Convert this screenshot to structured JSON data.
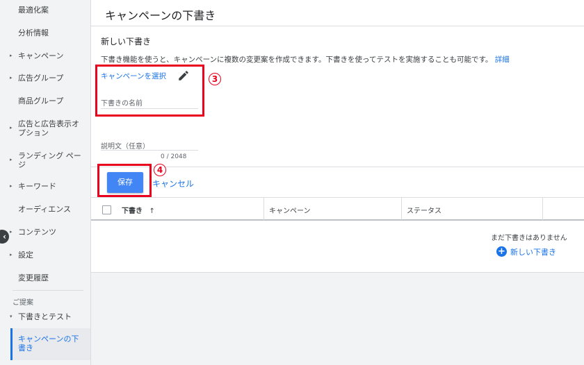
{
  "sidebar": {
    "items": [
      {
        "label": "最適化案",
        "arrow": ""
      },
      {
        "label": "分析情報",
        "arrow": ""
      },
      {
        "label": "キャンペーン",
        "arrow": "▸"
      },
      {
        "label": "広告グループ",
        "arrow": "▸"
      },
      {
        "label": "商品グループ",
        "arrow": ""
      },
      {
        "label": "広告と広告表示オプション",
        "arrow": "▸"
      },
      {
        "label": "ランディング ページ",
        "arrow": "▸"
      },
      {
        "label": "キーワード",
        "arrow": "▸"
      },
      {
        "label": "オーディエンス",
        "arrow": ""
      },
      {
        "label": "コンテンツ",
        "arrow": "▸"
      },
      {
        "label": "設定",
        "arrow": "▸"
      },
      {
        "label": "変更履歴",
        "arrow": ""
      }
    ],
    "section_label": "ご提案",
    "drafts_experiments": {
      "label": "下書きとテスト",
      "arrow": "▾"
    },
    "active_item": "キャンペーンの下書き",
    "collapse_icon": "‹"
  },
  "header": {
    "title": "キャンペーンの下書き"
  },
  "form": {
    "title": "新しい下書き",
    "description": "下書き機能を使うと、キャンペーンに複数の変更案を作成できます。下書きを使ってテストを実施することも可能です。",
    "details_link": "詳細",
    "select_campaign": "キャンペーンを選択",
    "draft_name_placeholder": "下書きの名前",
    "description_placeholder": "説明文（任意）",
    "char_counter": "0 / 2048",
    "save_label": "保存",
    "cancel_label": "キャンセル"
  },
  "table": {
    "columns": [
      "下書き",
      "キャンペーン",
      "ステータス"
    ],
    "sort_indicator": "↑",
    "empty_message": "まだ下書きはありません",
    "new_draft_label": "新しい下書き"
  },
  "callouts": {
    "three": "3",
    "four": "4"
  },
  "colors": {
    "accent": "#1a73e8",
    "save_button": "#4285f4",
    "callout_red": "#e8001c"
  }
}
